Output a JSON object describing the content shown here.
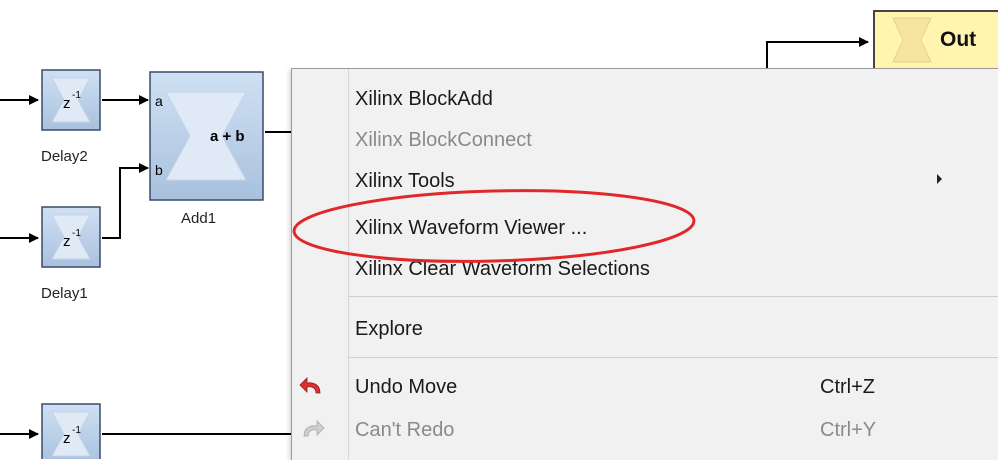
{
  "diagram": {
    "blocks": {
      "delay2": {
        "symbol": "z",
        "exponent": "-1",
        "label": "Delay2"
      },
      "delay1": {
        "symbol": "z",
        "exponent": "-1",
        "label": "Delay1"
      },
      "delay3": {
        "symbol": "z",
        "exponent": "-1"
      },
      "add1": {
        "label": "Add1",
        "port_a": "a",
        "port_b": "b",
        "expr": "a + b"
      },
      "out": {
        "label": "Out"
      }
    },
    "colors": {
      "block_fill": "#b7cce4",
      "block_border": "#3a4a6a",
      "output_fill": "#fff5b0",
      "highlight_ellipse": "#e0282a"
    }
  },
  "context_menu": {
    "items": [
      {
        "label": "Xilinx BlockAdd",
        "enabled": true
      },
      {
        "label": "Xilinx BlockConnect",
        "enabled": false
      },
      {
        "label": "Xilinx Tools",
        "enabled": true,
        "submenu": true
      },
      {
        "label": "Xilinx Waveform Viewer ...",
        "enabled": true,
        "highlighted": true
      },
      {
        "label": "Xilinx Clear Waveform Selections",
        "enabled": true
      },
      {
        "label": "Explore",
        "enabled": true
      },
      {
        "label": "Undo Move",
        "enabled": true,
        "shortcut": "Ctrl+Z",
        "icon": "undo-icon"
      },
      {
        "label": "Can't Redo",
        "enabled": false,
        "shortcut": "Ctrl+Y",
        "icon": "redo-icon"
      }
    ]
  }
}
